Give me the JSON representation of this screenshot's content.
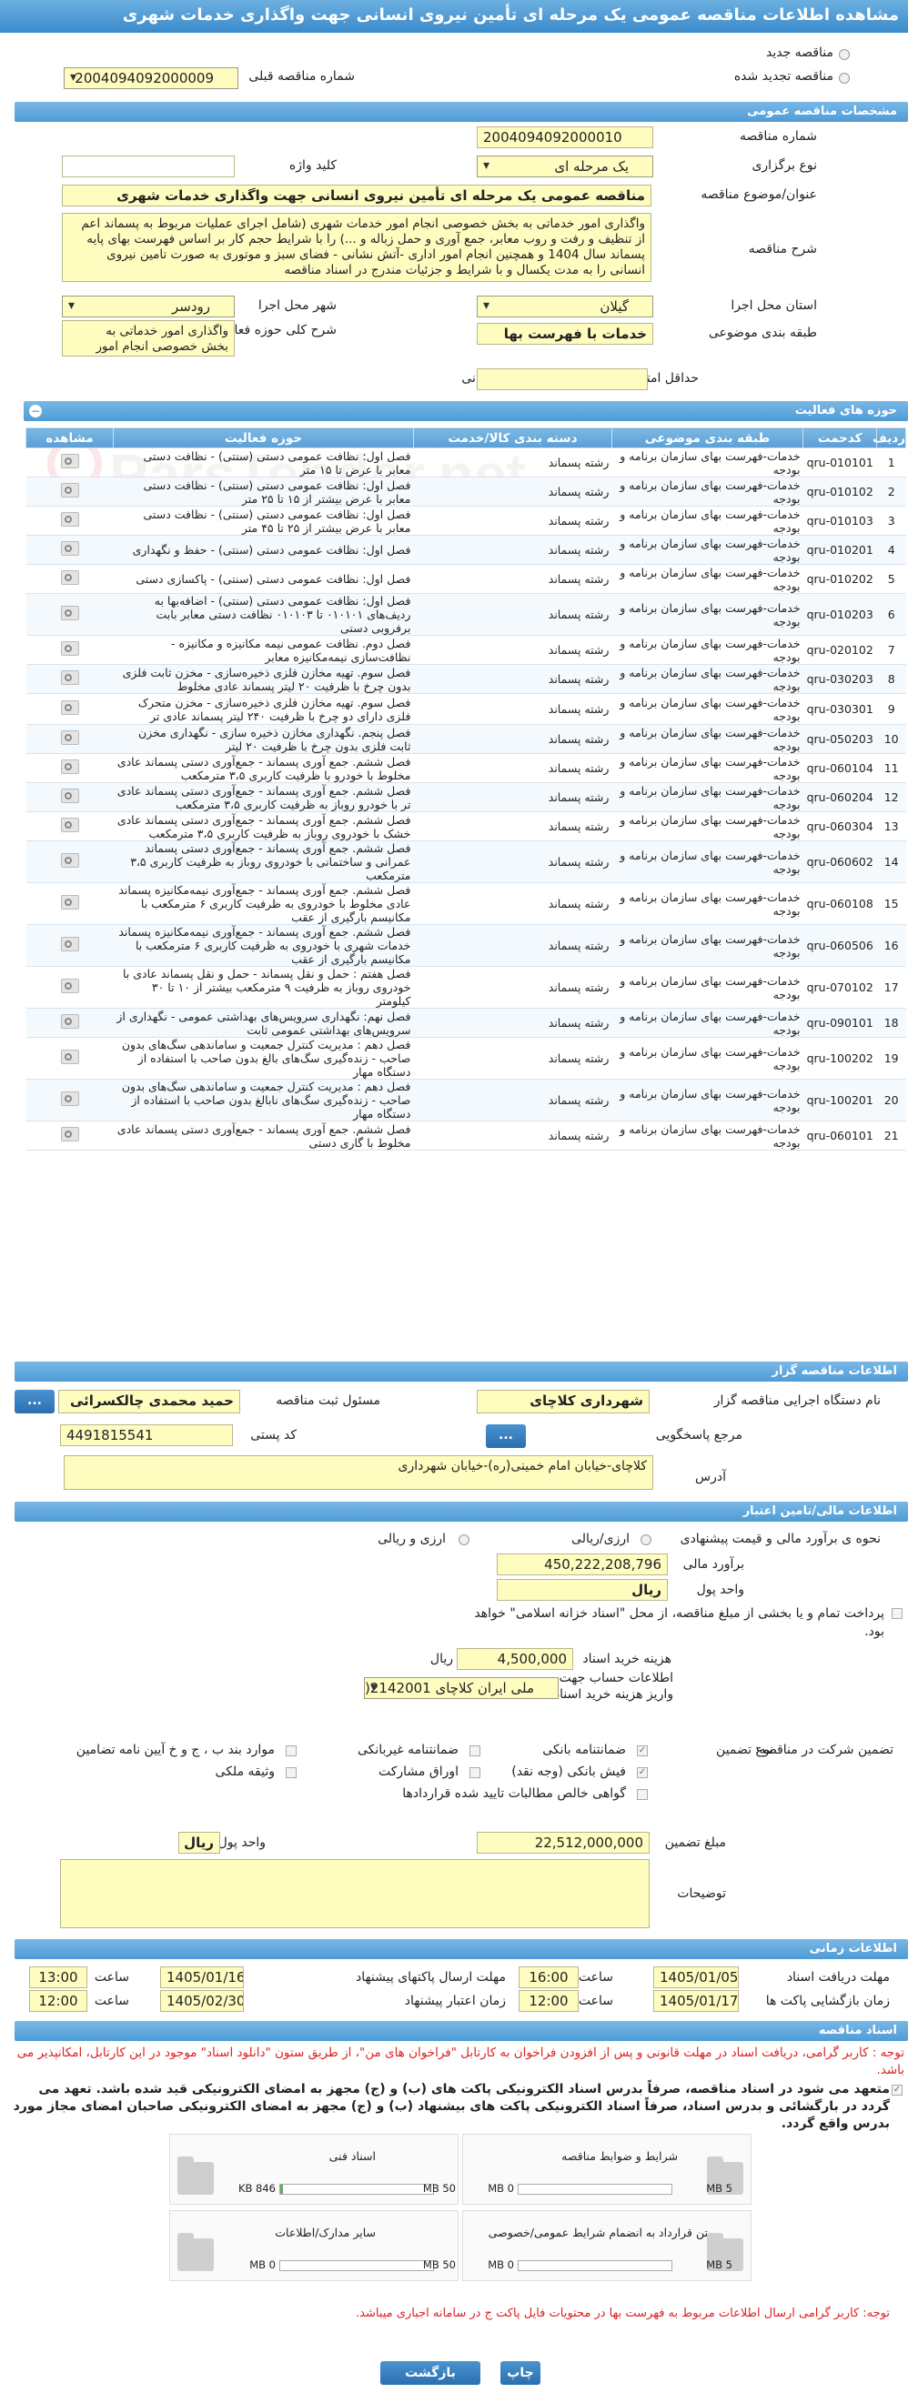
{
  "title": "مشاهده اطلاعات مناقصه عمومی یک مرحله ای تأمین نیروی انسانی جهت واگذاری خدمات شهری",
  "top": {
    "new_label": "مناقصه جدید",
    "renew_label": "مناقصه تجدید شده",
    "prev_label": "شماره مناقصه قبلی",
    "prev_value": "2004094092000009"
  },
  "general": {
    "section": "مشخصات مناقصه عمومی",
    "number_label": "شماره مناقصه",
    "number": "2004094092000010",
    "type_label": "نوع برگزاری",
    "type": "یک مرحله ای",
    "keyword_label": "کلید واژه",
    "keyword": "",
    "subject_label": "عنوان/موضوع مناقصه",
    "subject": "مناقصه عمومی یک مرحله ای تأمین نیروی انسانی جهت واگذاری خدمات شهری",
    "desc_label": "شرح مناقصه",
    "desc": "واگذاری امور خدماتی به بخش خصوصی انجام امور خدمات شهری (شامل اجرای عملیات مربوط به پسماند اعم از تنظیف و رفت و روب معابر، جمع آوری و حمل زباله و ...) را با شرایط حجم کار بر اساس فهرست بهای پایه پسماند سال 1404 و همچنین انجام امور  اداری -آتش نشانی - فضای سبز و  موتوری به صورت تامین نیروی انسانی را به مدت یکسال و با شرایط و جزئیات مندرج در اسناد مناقصه",
    "province_label": "استان محل اجرا",
    "province": "گیلان",
    "city_label": "شهر محل اجرا",
    "city": "رودسر",
    "category_label": "طبقه بندی موضوعی",
    "category": "خدمات با فهرست بها",
    "scope_label": "شرح کلی حوزه فعالیت",
    "scope": "واگذاری امور خدماتی به بخش خصوصی انجام امور",
    "score_label": "حداقل امتیاز قابل قبول ارزیابی فنی/بازرگانی",
    "score": ""
  },
  "grid": {
    "section": "حوزه های فعالیت",
    "headers": [
      "ردیف",
      "کدحمت",
      "طبقه بندی موضوعی",
      "دسته بندی کالا/خدمت",
      "حوزه فعالیت",
      "مشاهده"
    ],
    "rows": [
      [
        "1",
        "qru-010101",
        "خدمات-فهرست بهای سازمان برنامه و بودجه",
        "رشته پسماند",
        "فصل اول: نظافت عمومی دستی (سنتی) - نظافت دستی معابر با عرض تا ۱۵ متر"
      ],
      [
        "2",
        "qru-010102",
        "خدمات-فهرست بهای سازمان برنامه و بودجه",
        "رشته پسماند",
        "فصل اول: نظافت عمومی دستی (سنتی) - نظافت دستی معابر با عرض بیشتر از ۱۵ تا ۲۵ متر"
      ],
      [
        "3",
        "qru-010103",
        "خدمات-فهرست بهای سازمان برنامه و بودجه",
        "رشته پسماند",
        "فصل اول: نظافت عمومی دستی (سنتی) - نظافت دستی معابر با عرض بیشتر از ۲۵ تا ۴۵ متر"
      ],
      [
        "4",
        "qru-010201",
        "خدمات-فهرست بهای سازمان برنامه و بودجه",
        "رشته پسماند",
        "فصل اول: نظافت عمومی دستی (سنتی) - حفظ و نگهداری"
      ],
      [
        "5",
        "qru-010202",
        "خدمات-فهرست بهای سازمان برنامه و بودجه",
        "رشته پسماند",
        "فصل اول: نظافت عمومی دستی (سنتی) - پاکسازی دستی"
      ],
      [
        "6",
        "qru-010203",
        "خدمات-فهرست بهای سازمان برنامه و بودجه",
        "رشته پسماند",
        "فصل اول: نظافت عمومی دستی (سنتی) - اضافه‌بها به ردیف‌های ۰۱۰۱۰۱ تا ۰۱۰۱۰۳ نظافت دستی معابر بابت برفروبی دستی"
      ],
      [
        "7",
        "qru-020102",
        "خدمات-فهرست بهای سازمان برنامه و بودجه",
        "رشته پسماند",
        "فصل دوم. نظافت عمومی نیمه مکانیزه و مکانیزه - نظافت‌سازی نیمه‌مکانیزه معابر"
      ],
      [
        "8",
        "qru-030203",
        "خدمات-فهرست بهای سازمان برنامه و بودجه",
        "رشته پسماند",
        "فصل سوم. تهیه مخازن فلزی ذخیره‌سازی - مخزن ثابت فلزی بدون چرخ با ظرفیت ۲۰ لیتر پسماند عادی مخلوط"
      ],
      [
        "9",
        "qru-030301",
        "خدمات-فهرست بهای سازمان برنامه و بودجه",
        "رشته پسماند",
        "فصل سوم. تهیه مخازن فلزی ذخیره‌سازی - مخزن متحرک فلزی دارای دو چرخ با ظرفیت ۲۴۰ لیتر پسماند عادی تر"
      ],
      [
        "10",
        "qru-050203",
        "خدمات-فهرست بهای سازمان برنامه و بودجه",
        "رشته پسماند",
        "فصل پنجم. نگهداری مخازن ذخیره سازی - نگهداری مخزن ثابت فلزی بدون چرخ با ظرفیت ۲۰ لیتر"
      ],
      [
        "11",
        "qru-060104",
        "خدمات-فهرست بهای سازمان برنامه و بودجه",
        "رشته پسماند",
        "فصل ششم. جمع آوری پسماند - جمع‌آوری دستی پسماند عادی مخلوط با خودرو با ظرفیت کاربری ۳،۵ مترمکعب"
      ],
      [
        "12",
        "qru-060204",
        "خدمات-فهرست بهای سازمان برنامه و بودجه",
        "رشته پسماند",
        "فصل ششم. جمع آوری پسماند - جمع‌آوری دستی پسماند عادی تر با خودرو روباز به ظرفیت کاربری ۳،۵ مترمکعب"
      ],
      [
        "13",
        "qru-060304",
        "خدمات-فهرست بهای سازمان برنامه و بودجه",
        "رشته پسماند",
        "فصل ششم. جمع آوری پسماند - جمع‌آوری دستی پسماند عادی خشک با خودروی روباز به ظرفیت کاربری ۳،۵ مترمکعب"
      ],
      [
        "14",
        "qru-060602",
        "خدمات-فهرست بهای سازمان برنامه و بودجه",
        "رشته پسماند",
        "فصل ششم. جمع آوری پسماند - جمع‌آوری دستی پسماند عمرانی و ساختمانی با خودروی روباز به ظرفیت کاربری ۳،۵ مترمکعب"
      ],
      [
        "15",
        "qru-060108",
        "خدمات-فهرست بهای سازمان برنامه و بودجه",
        "رشته پسماند",
        "فصل ششم. جمع آوری پسماند - جمع‌آوری نیمه‌مکانیزه پسماند عادی مخلوط با خودروی به ظرفیت کاربری ۶ مترمکعب با مکانیسم بارگیری از عقب"
      ],
      [
        "16",
        "qru-060506",
        "خدمات-فهرست بهای سازمان برنامه و بودجه",
        "رشته پسماند",
        "فصل ششم. جمع آوری پسماند - جمع‌آوری نیمه‌مکانیزه پسماند خدمات شهری با خودروی به ظرفیت کاربری ۶ مترمکعب با مکانیسم بارگیری از عقب"
      ],
      [
        "17",
        "qru-070102",
        "خدمات-فهرست بهای سازمان برنامه و بودجه",
        "رشته پسماند",
        "فصل هفتم : حمل و نقل پسماند - حمل و نقل پسماند عادی با خودروی روباز به ظرفیت ۹ مترمکعب بیشتر از ۱۰ تا ۳۰ کیلومتر"
      ],
      [
        "18",
        "qru-090101",
        "خدمات-فهرست بهای سازمان برنامه و بودجه",
        "رشته پسماند",
        "فصل نهم: نگهداری سرویس‌های بهداشتی عمومی - نگهداری از سرویس‌های بهداشتی عمومی ثابت"
      ],
      [
        "19",
        "qru-100202",
        "خدمات-فهرست بهای سازمان برنامه و بودجه",
        "رشته پسماند",
        "فصل دهم : مدیریت کنترل جمعیت و ساماندهی سگ‌های بدون صاحب - زنده‌گیری سگ‌های بالغ بدون صاحب با استفاده از دستگاه مهار"
      ],
      [
        "20",
        "qru-100201",
        "خدمات-فهرست بهای سازمان برنامه و بودجه",
        "رشته پسماند",
        "فصل دهم : مدیریت کنترل جمعیت و ساماندهی سگ‌های بدون صاحب - زنده‌گیری سگ‌های نابالغ بدون صاحب با استفاده از دستگاه مهار"
      ],
      [
        "21",
        "qru-060101",
        "خدمات-فهرست بهای سازمان برنامه و بودجه",
        "رشته پسماند",
        "فصل ششم. جمع آوری پسماند - جمع‌آوری دستی پسماند عادی مخلوط با گاری دستی"
      ]
    ]
  },
  "organizer": {
    "section": "اطلاعات مناقصه گزار",
    "org_label": "نام دستگاه اجرایی مناقصه گزار",
    "org": "شهرداری کلاچای",
    "resp_label": "مسئول ثبت مناقصه",
    "resp": "حمید محمدی چالکسرائی",
    "ref_label": "مرجع پاسخگویی",
    "postal_label": "کد پستی",
    "postal": "4491815541",
    "addr_label": "آدرس",
    "addr": "کلاچای-خیابان امام خمینی(ره)-خیابان شهرداری",
    "more": "..."
  },
  "finance": {
    "section": "اطلاعات مالی/تامین اعتبار",
    "est_type_label": "نحوه ی برآورد مالی و قیمت پیشنهادی",
    "rial_label": "ارزی/ریالی",
    "fx_label": "ارزی و ریالی",
    "est_label": "برآورد مالی",
    "est": "450,222,208,796",
    "unit_label": "واحد پول",
    "unit": "ریال",
    "treasury": "پرداخت تمام و یا بخشی از مبلغ مناقصه، از محل \"اسناد خزانه اسلامی\" خواهد بود.",
    "fee_label": "هزینه خرید اسناد",
    "fee": "4,500,000",
    "fee_unit": "ریال",
    "acct_label": "اطلاعات حساب جهت واریز هزینه خرید اسناد",
    "acct": "ملی ایران کلاچای 2142001(",
    "guar_label": "تضمین شرکت در مناقصه:",
    "guar_type_label": "نوع تضمین",
    "g1": "ضمانتنامه بانکی",
    "g2": "ضمانتنامه غیربانکی",
    "g3": "موارد بند ب ، ج و خ آیین نامه تضامین",
    "g4": "فیش بانکی (وجه نقد)",
    "g5": "اوراق مشارکت",
    "g6": "وثیقه ملکی",
    "g7": "گواهی خالص مطالبات تایید شده قراردادها",
    "amt_label": "مبلغ تضمین",
    "amt": "22,512,000,000",
    "amt_unit_label": "واحد پول",
    "amt_unit": "ریال",
    "notes_label": "توضیحات"
  },
  "times": {
    "section": "اطلاعات زمانی",
    "recv_label": "مهلت دریافت اسناد",
    "recv_date": "1405/01/05",
    "recv_time": "16:00",
    "send_label": "مهلت ارسال پاکتهای پیشنهاد",
    "send_date": "1405/01/16",
    "send_time": "13:00",
    "open_label": "زمان بازگشایی پاکت ها",
    "open_date": "1405/01/17",
    "open_time": "12:00",
    "valid_label": "زمان اعتبار پیشنهاد",
    "valid_date": "1405/02/30",
    "valid_time": "12:00",
    "time_label": "ساعت"
  },
  "docs": {
    "section": "اسناد مناقصه",
    "warn": "توجه : کاربر گرامی، دریافت اسناد در مهلت قانونی و پس از افزودن فراخوان به کارتابل \"فراخوان های من\"، از طریق ستون \"دانلود اسناد\" موجود در این کارتابل، امکانپذیر می باشد.",
    "commit": "متعهد می شود در اسناد مناقصه، صرفاً بدرس اسناد الکترونیکی پاکت های (ب) و (ج) مجهز به امضای الکترونیکی قید شده باشد. تعهد می گردد در بارگشائی و بدرس اسناد، صرفاً اسناد الکترونیکی پاکت های بیشنهاد (ب) و (ج) مجهز به امضای الکترونیکی صاحبان امضای مجاز مورد بدرس واقع گردد.",
    "d1": "شرایط و ضوابط مناقصه",
    "d1_size": "0 MB",
    "d1_max": "5 MB",
    "d2": "اسناد فنی",
    "d2_size": "846 KB",
    "d2_max": "50 MB",
    "d3": "متن قرارداد به انضمام شرایط عمومی/خصوصی",
    "d3_size": "0 MB",
    "d3_max": "5 MB",
    "d4": "سایر مدارک/اطلاعات",
    "d4_size": "0 MB",
    "d4_max": "50 MB",
    "note2": "توجه: کاربر گرامی ارسال اطلاعات مربوط به فهرست بها در محتویات فایل پاکت ج در سامانه اجباری میباشد."
  },
  "buttons": {
    "print": "چاپ",
    "back": "بازگشت"
  },
  "watermark": "ParsTender.net"
}
